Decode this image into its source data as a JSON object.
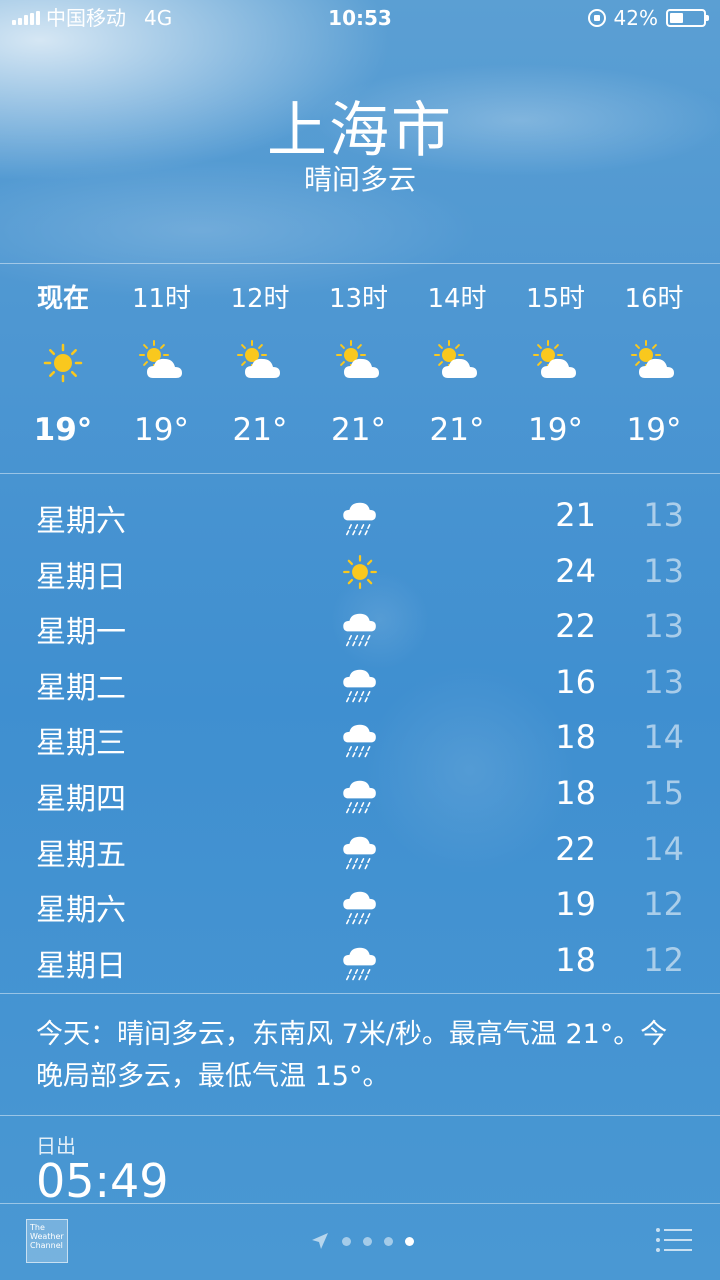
{
  "status_bar": {
    "carrier": "中国移动",
    "network": "4G",
    "time": "10:53",
    "battery_percent": "42%",
    "battery_level": 0.42
  },
  "location": {
    "city": "上海市",
    "condition": "晴间多云"
  },
  "hourly": [
    {
      "label": "现在",
      "temp": "19°",
      "icon": "sun-icon"
    },
    {
      "label": "11时",
      "temp": "19°",
      "icon": "partly-cloudy-icon"
    },
    {
      "label": "12时",
      "temp": "21°",
      "icon": "partly-cloudy-icon"
    },
    {
      "label": "13时",
      "temp": "21°",
      "icon": "partly-cloudy-icon"
    },
    {
      "label": "14时",
      "temp": "21°",
      "icon": "partly-cloudy-icon"
    },
    {
      "label": "15时",
      "temp": "19°",
      "icon": "partly-cloudy-icon"
    },
    {
      "label": "16时",
      "temp": "19°",
      "icon": "partly-cloudy-icon"
    }
  ],
  "daily": [
    {
      "day": "星期六",
      "icon": "rain-icon",
      "high": "21",
      "low": "13"
    },
    {
      "day": "星期日",
      "icon": "sun-icon",
      "high": "24",
      "low": "13"
    },
    {
      "day": "星期一",
      "icon": "rain-icon",
      "high": "22",
      "low": "13"
    },
    {
      "day": "星期二",
      "icon": "rain-icon",
      "high": "16",
      "low": "13"
    },
    {
      "day": "星期三",
      "icon": "rain-icon",
      "high": "18",
      "low": "14"
    },
    {
      "day": "星期四",
      "icon": "rain-icon",
      "high": "18",
      "low": "15"
    },
    {
      "day": "星期五",
      "icon": "rain-icon",
      "high": "22",
      "low": "14"
    },
    {
      "day": "星期六",
      "icon": "rain-icon",
      "high": "19",
      "low": "12"
    },
    {
      "day": "星期日",
      "icon": "rain-icon",
      "high": "18",
      "low": "12"
    }
  ],
  "summary": "今天：晴间多云，东南风 7米/秒。最高气温 21°。今晚局部多云，最低气温 15°。",
  "sunrise": {
    "label": "日出",
    "time": "05:49"
  },
  "bottom_bar": {
    "logo_text": "The Weather Channel",
    "page_count": 4,
    "active_page": 4
  },
  "colors": {
    "sky_top": "#5b9fd3",
    "sky_bottom": "#4a98d3",
    "sun": "#f9c81e"
  }
}
